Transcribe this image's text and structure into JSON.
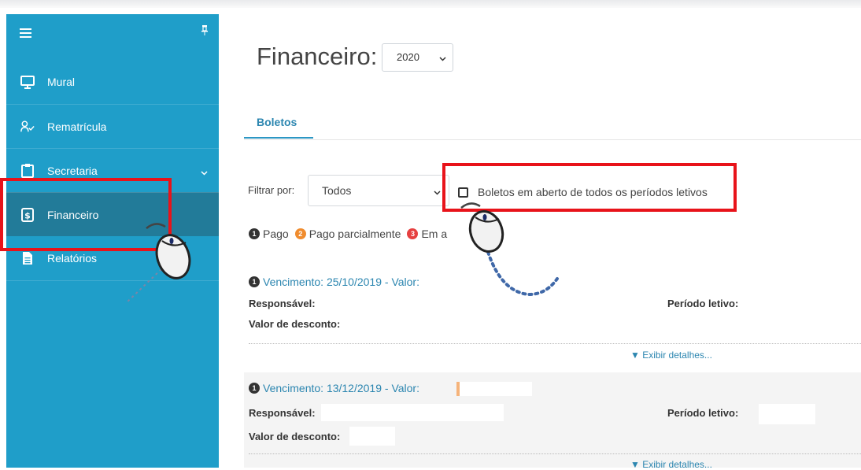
{
  "sidebar": {
    "items": [
      {
        "label": "Mural",
        "icon": "monitor-icon"
      },
      {
        "label": "Rematrícula",
        "icon": "user-check-icon"
      },
      {
        "label": "Secretaria",
        "icon": "clipboard-icon"
      },
      {
        "label": "Financeiro",
        "icon": "dollar-doc-icon"
      },
      {
        "label": "Relatórios",
        "icon": "file-icon"
      }
    ],
    "active": "Financeiro",
    "color": "#1f9ec9",
    "active_color": "#227b99"
  },
  "header": {
    "title": "Financeiro:",
    "year": "2020"
  },
  "tabs": [
    {
      "label": "Boletos"
    }
  ],
  "filter": {
    "label": "Filtrar por:",
    "value": "Todos",
    "checkbox_label": "Boletos em aberto de todos os períodos letivos"
  },
  "legend": [
    {
      "num": "1",
      "label": "Pago",
      "color": "#333333"
    },
    {
      "num": "2",
      "label": "Pago parcialmente",
      "color": "#f08c2e"
    },
    {
      "num": "3",
      "label": "Em a",
      "color": "#e64040"
    }
  ],
  "records": [
    {
      "badge": "1",
      "title": "Vencimento: 25/10/2019 - Valor:",
      "responsavel_label": "Responsável:",
      "periodo_label": "Período letivo:",
      "desconto_label": "Valor de desconto:",
      "details_label": "▼ Exibir detalhes..."
    },
    {
      "badge": "1",
      "title": "Vencimento: 13/12/2019 - Valor:",
      "responsavel_label": "Responsável:",
      "periodo_label": "Período letivo:",
      "desconto_label": "Valor de desconto:",
      "details_label": "▼ Exibir detalhes..."
    }
  ],
  "highlight_color": "#e8131a"
}
